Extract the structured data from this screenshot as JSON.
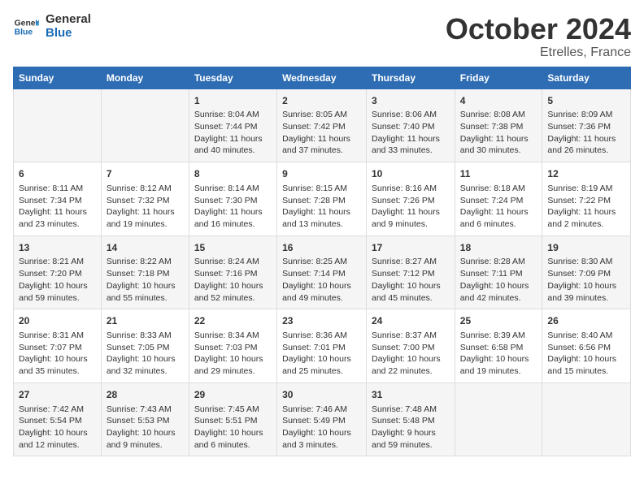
{
  "header": {
    "logo_line1": "General",
    "logo_line2": "Blue",
    "month": "October 2024",
    "location": "Etrelles, France"
  },
  "weekdays": [
    "Sunday",
    "Monday",
    "Tuesday",
    "Wednesday",
    "Thursday",
    "Friday",
    "Saturday"
  ],
  "weeks": [
    [
      {
        "day": "",
        "info": ""
      },
      {
        "day": "",
        "info": ""
      },
      {
        "day": "1",
        "info": "Sunrise: 8:04 AM\nSunset: 7:44 PM\nDaylight: 11 hours and 40 minutes."
      },
      {
        "day": "2",
        "info": "Sunrise: 8:05 AM\nSunset: 7:42 PM\nDaylight: 11 hours and 37 minutes."
      },
      {
        "day": "3",
        "info": "Sunrise: 8:06 AM\nSunset: 7:40 PM\nDaylight: 11 hours and 33 minutes."
      },
      {
        "day": "4",
        "info": "Sunrise: 8:08 AM\nSunset: 7:38 PM\nDaylight: 11 hours and 30 minutes."
      },
      {
        "day": "5",
        "info": "Sunrise: 8:09 AM\nSunset: 7:36 PM\nDaylight: 11 hours and 26 minutes."
      }
    ],
    [
      {
        "day": "6",
        "info": "Sunrise: 8:11 AM\nSunset: 7:34 PM\nDaylight: 11 hours and 23 minutes."
      },
      {
        "day": "7",
        "info": "Sunrise: 8:12 AM\nSunset: 7:32 PM\nDaylight: 11 hours and 19 minutes."
      },
      {
        "day": "8",
        "info": "Sunrise: 8:14 AM\nSunset: 7:30 PM\nDaylight: 11 hours and 16 minutes."
      },
      {
        "day": "9",
        "info": "Sunrise: 8:15 AM\nSunset: 7:28 PM\nDaylight: 11 hours and 13 minutes."
      },
      {
        "day": "10",
        "info": "Sunrise: 8:16 AM\nSunset: 7:26 PM\nDaylight: 11 hours and 9 minutes."
      },
      {
        "day": "11",
        "info": "Sunrise: 8:18 AM\nSunset: 7:24 PM\nDaylight: 11 hours and 6 minutes."
      },
      {
        "day": "12",
        "info": "Sunrise: 8:19 AM\nSunset: 7:22 PM\nDaylight: 11 hours and 2 minutes."
      }
    ],
    [
      {
        "day": "13",
        "info": "Sunrise: 8:21 AM\nSunset: 7:20 PM\nDaylight: 10 hours and 59 minutes."
      },
      {
        "day": "14",
        "info": "Sunrise: 8:22 AM\nSunset: 7:18 PM\nDaylight: 10 hours and 55 minutes."
      },
      {
        "day": "15",
        "info": "Sunrise: 8:24 AM\nSunset: 7:16 PM\nDaylight: 10 hours and 52 minutes."
      },
      {
        "day": "16",
        "info": "Sunrise: 8:25 AM\nSunset: 7:14 PM\nDaylight: 10 hours and 49 minutes."
      },
      {
        "day": "17",
        "info": "Sunrise: 8:27 AM\nSunset: 7:12 PM\nDaylight: 10 hours and 45 minutes."
      },
      {
        "day": "18",
        "info": "Sunrise: 8:28 AM\nSunset: 7:11 PM\nDaylight: 10 hours and 42 minutes."
      },
      {
        "day": "19",
        "info": "Sunrise: 8:30 AM\nSunset: 7:09 PM\nDaylight: 10 hours and 39 minutes."
      }
    ],
    [
      {
        "day": "20",
        "info": "Sunrise: 8:31 AM\nSunset: 7:07 PM\nDaylight: 10 hours and 35 minutes."
      },
      {
        "day": "21",
        "info": "Sunrise: 8:33 AM\nSunset: 7:05 PM\nDaylight: 10 hours and 32 minutes."
      },
      {
        "day": "22",
        "info": "Sunrise: 8:34 AM\nSunset: 7:03 PM\nDaylight: 10 hours and 29 minutes."
      },
      {
        "day": "23",
        "info": "Sunrise: 8:36 AM\nSunset: 7:01 PM\nDaylight: 10 hours and 25 minutes."
      },
      {
        "day": "24",
        "info": "Sunrise: 8:37 AM\nSunset: 7:00 PM\nDaylight: 10 hours and 22 minutes."
      },
      {
        "day": "25",
        "info": "Sunrise: 8:39 AM\nSunset: 6:58 PM\nDaylight: 10 hours and 19 minutes."
      },
      {
        "day": "26",
        "info": "Sunrise: 8:40 AM\nSunset: 6:56 PM\nDaylight: 10 hours and 15 minutes."
      }
    ],
    [
      {
        "day": "27",
        "info": "Sunrise: 7:42 AM\nSunset: 5:54 PM\nDaylight: 10 hours and 12 minutes."
      },
      {
        "day": "28",
        "info": "Sunrise: 7:43 AM\nSunset: 5:53 PM\nDaylight: 10 hours and 9 minutes."
      },
      {
        "day": "29",
        "info": "Sunrise: 7:45 AM\nSunset: 5:51 PM\nDaylight: 10 hours and 6 minutes."
      },
      {
        "day": "30",
        "info": "Sunrise: 7:46 AM\nSunset: 5:49 PM\nDaylight: 10 hours and 3 minutes."
      },
      {
        "day": "31",
        "info": "Sunrise: 7:48 AM\nSunset: 5:48 PM\nDaylight: 9 hours and 59 minutes."
      },
      {
        "day": "",
        "info": ""
      },
      {
        "day": "",
        "info": ""
      }
    ]
  ]
}
